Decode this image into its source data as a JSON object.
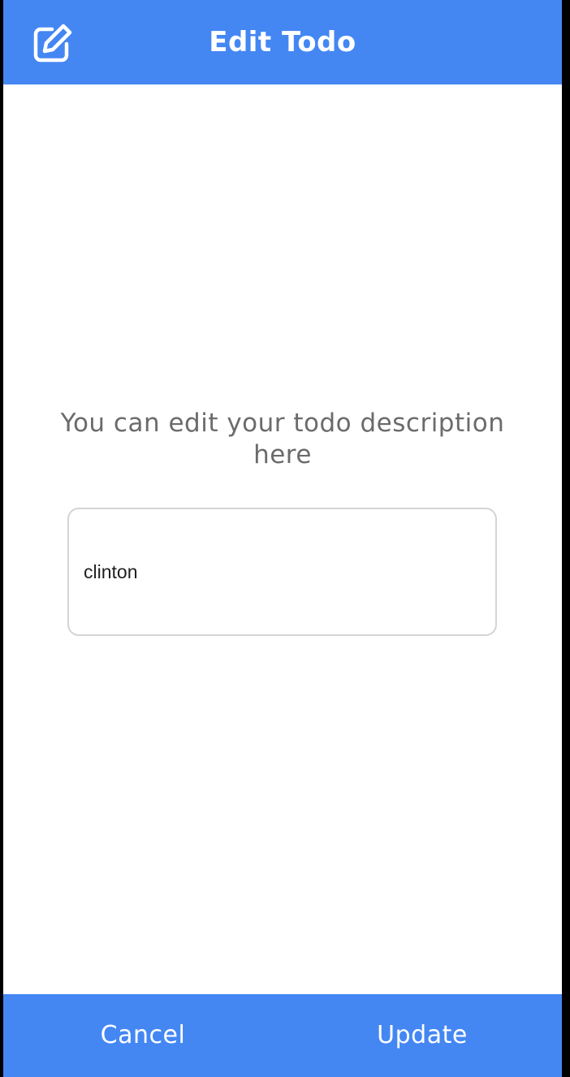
{
  "header": {
    "title": "Edit Todo",
    "icon": "edit-icon",
    "background_color": "#4487f3"
  },
  "main": {
    "prompt": "You can edit your todo description here",
    "input": {
      "value": "clinton",
      "placeholder": ""
    }
  },
  "footer": {
    "cancel_label": "Cancel",
    "update_label": "Update",
    "background_color": "#4487f3"
  }
}
